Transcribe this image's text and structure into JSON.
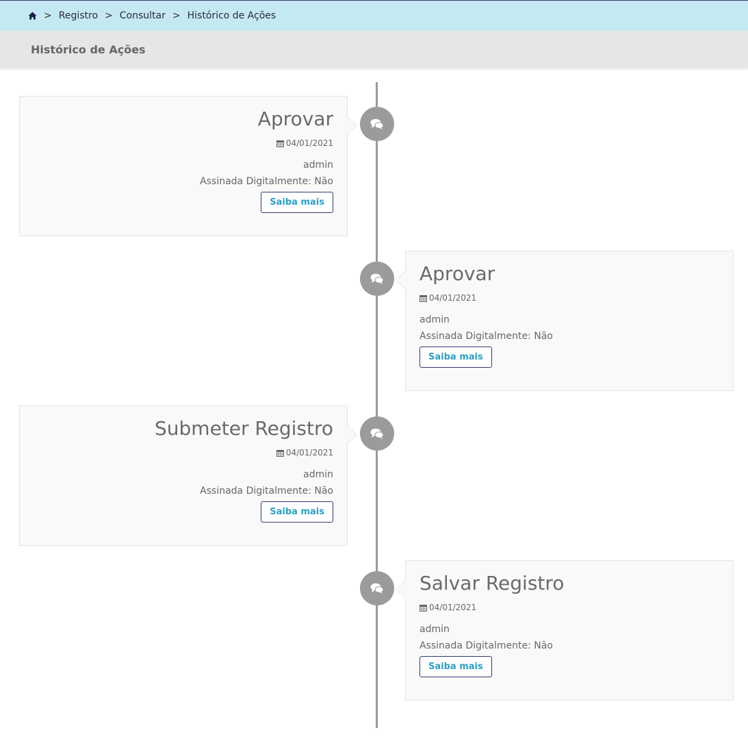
{
  "breadcrumb": {
    "home_icon": "home-icon",
    "separator": ">",
    "items": [
      "Registro",
      "Consultar",
      "Histórico de Ações"
    ]
  },
  "header": {
    "title": "Histórico de Ações"
  },
  "timeline": {
    "badge_icon": "comments-icon",
    "date_icon": "calendar-icon",
    "entries": [
      {
        "title": "Aprovar",
        "date": "04/01/2021",
        "user": "admin",
        "signed": "Assinada Digitalmente: Não",
        "button": "Saiba mais"
      },
      {
        "title": "Aprovar",
        "date": "04/01/2021",
        "user": "admin",
        "signed": "Assinada Digitalmente: Não",
        "button": "Saiba mais"
      },
      {
        "title": "Submeter Registro",
        "date": "04/01/2021",
        "user": "admin",
        "signed": "Assinada Digitalmente: Não",
        "button": "Saiba mais"
      },
      {
        "title": "Salvar Registro",
        "date": "04/01/2021",
        "user": "admin",
        "signed": "Assinada Digitalmente: Não",
        "button": "Saiba mais"
      }
    ]
  },
  "colors": {
    "breadcrumb_bg": "#c5e9f3",
    "header_bg": "#e6e6e6",
    "timeline_line": "#9a9a9a",
    "badge_bg": "#9b9b9b",
    "button_text": "#2a9fc6",
    "button_border": "#2f3a6e"
  }
}
